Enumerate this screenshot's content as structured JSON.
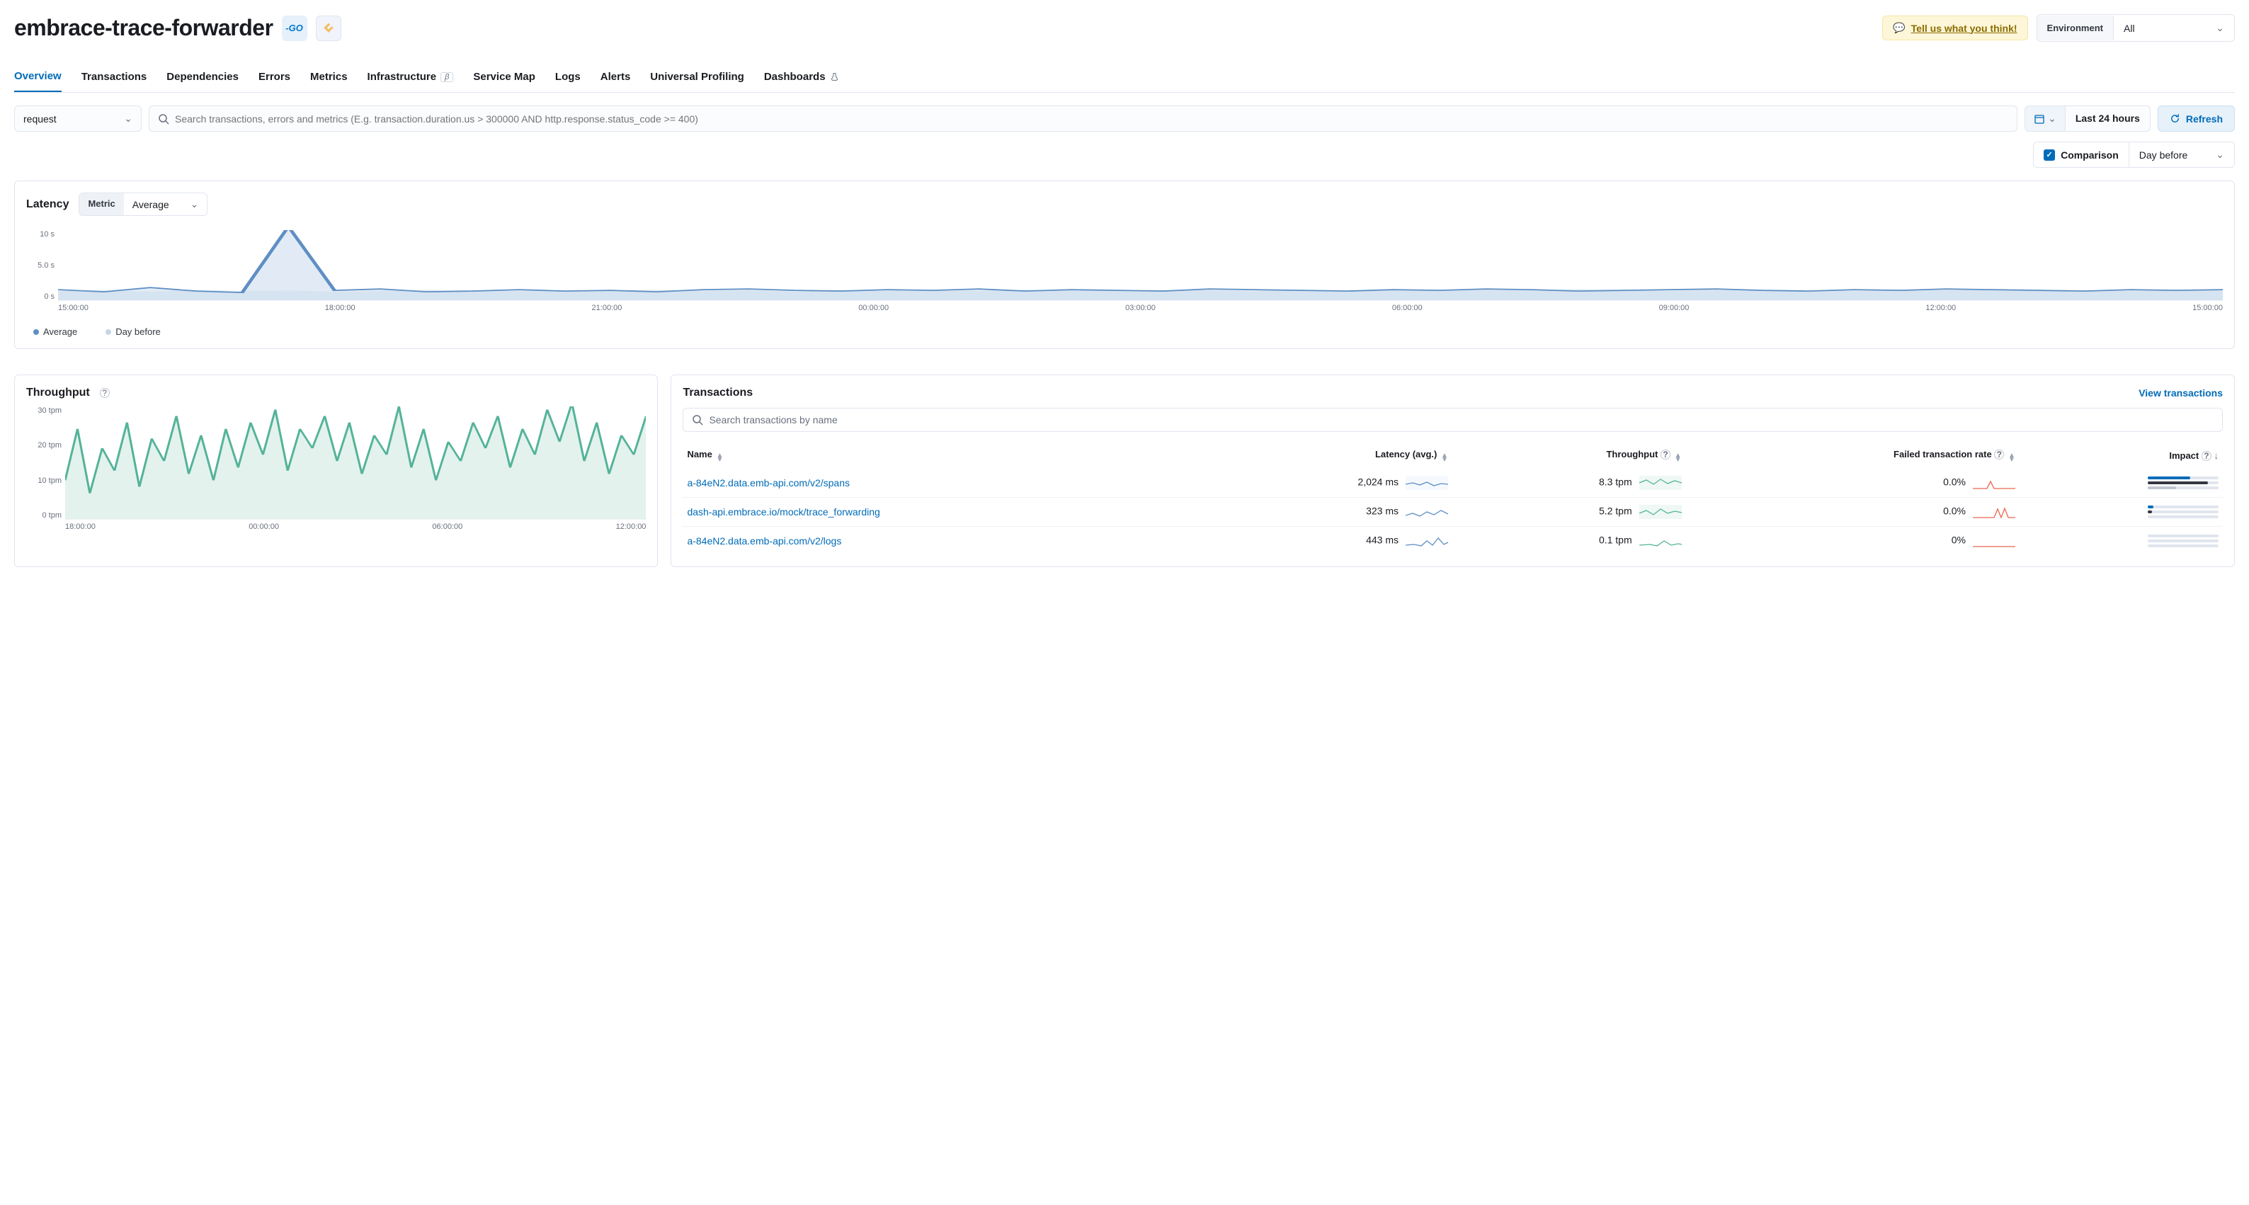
{
  "header": {
    "title": "embrace-trace-forwarder",
    "go_badge": "-GO",
    "feedback_label": "Tell us what you think!",
    "env_label": "Environment",
    "env_value": "All"
  },
  "tabs": [
    "Overview",
    "Transactions",
    "Dependencies",
    "Errors",
    "Metrics",
    "Infrastructure",
    "Service Map",
    "Logs",
    "Alerts",
    "Universal Profiling",
    "Dashboards"
  ],
  "tabs_active_index": 0,
  "tabs_beta_index": 5,
  "tabs_flask_index": 10,
  "filter": {
    "type_select": "request",
    "search_placeholder": "Search transactions, errors and metrics (E.g. transaction.duration.us > 300000 AND http.response.status_code >= 400)",
    "date_range": "Last 24 hours",
    "refresh_label": "Refresh"
  },
  "comparison": {
    "label": "Comparison",
    "value": "Day before"
  },
  "latency": {
    "title": "Latency",
    "metric_label": "Metric",
    "metric_value": "Average",
    "legend_avg": "Average",
    "legend_before": "Day before"
  },
  "throughput": {
    "title": "Throughput"
  },
  "transactions": {
    "title": "Transactions",
    "view_link": "View transactions",
    "search_placeholder": "Search transactions by name",
    "cols": {
      "name": "Name",
      "latency": "Latency (avg.)",
      "throughput": "Throughput",
      "failed": "Failed transaction rate",
      "impact": "Impact"
    },
    "rows": [
      {
        "name": "a-84eN2.data.emb-api.com/v2/spans",
        "latency": "2,024 ms",
        "throughput": "8.3 tpm",
        "failed": "0.0%"
      },
      {
        "name": "dash-api.embrace.io/mock/trace_forwarding",
        "latency": "323 ms",
        "throughput": "5.2 tpm",
        "failed": "0.0%"
      },
      {
        "name": "a-84eN2.data.emb-api.com/v2/logs",
        "latency": "443 ms",
        "throughput": "0.1 tpm",
        "failed": "0%"
      }
    ]
  },
  "chart_data": [
    {
      "type": "line",
      "title": "Latency",
      "ylabel": "seconds",
      "y_ticks": [
        "10 s",
        "5.0 s",
        "0 s"
      ],
      "x_ticks": [
        "15:00:00",
        "18:00:00",
        "21:00:00",
        "00:00:00",
        "03:00:00",
        "06:00:00",
        "09:00:00",
        "12:00:00",
        "15:00:00"
      ],
      "ylim": [
        0,
        10
      ],
      "series": [
        {
          "name": "Average",
          "color": "#5e8fc4",
          "values_approx_s": [
            1.5,
            1.2,
            1.8,
            1.3,
            1.1,
            10.5,
            1.4,
            1.6,
            1.2,
            1.3,
            1.5,
            1.3,
            1.4,
            1.2,
            1.5,
            1.6,
            1.4,
            1.3,
            1.5,
            1.4,
            1.6,
            1.3,
            1.5,
            1.4,
            1.3,
            1.6,
            1.5,
            1.4,
            1.3,
            1.5,
            1.4,
            1.6,
            1.5,
            1.3,
            1.4,
            1.5,
            1.6,
            1.4,
            1.3,
            1.5,
            1.4,
            1.6,
            1.5,
            1.4,
            1.3,
            1.5,
            1.4,
            1.5
          ]
        },
        {
          "name": "Day before",
          "color": "#c5d5e8",
          "values_approx_s": [
            1.3,
            1.4,
            1.2,
            1.5,
            1.3,
            1.4,
            1.2,
            1.3,
            1.5,
            1.4,
            1.3,
            1.2,
            1.4,
            1.5,
            1.3,
            1.4,
            1.2,
            1.5,
            1.3,
            1.4,
            1.3,
            1.5,
            1.4,
            1.3,
            1.5,
            1.4,
            1.3,
            1.5,
            1.4,
            1.6,
            1.3,
            1.5,
            1.4,
            1.6,
            1.5,
            1.3,
            1.4,
            1.5,
            1.4,
            1.3,
            1.5,
            1.4,
            1.6,
            1.5,
            1.4,
            1.3,
            1.5,
            1.4
          ]
        }
      ]
    },
    {
      "type": "line",
      "title": "Throughput",
      "ylabel": "tpm",
      "y_ticks": [
        "30 tpm",
        "20 tpm",
        "10 tpm",
        "0 tpm"
      ],
      "x_ticks": [
        "18:00:00",
        "00:00:00",
        "06:00:00",
        "12:00:00"
      ],
      "ylim": [
        0,
        35
      ],
      "series": [
        {
          "name": "Throughput",
          "color": "#54b399",
          "values_approx_tpm": [
            12,
            28,
            8,
            22,
            15,
            30,
            10,
            25,
            18,
            32,
            14,
            26,
            12,
            28,
            16,
            30,
            20,
            34,
            15,
            28,
            22,
            32,
            18,
            30,
            14,
            26,
            20,
            35,
            16,
            28,
            12,
            24,
            18,
            30,
            22,
            32,
            16,
            28,
            20,
            34,
            24,
            36,
            18,
            30,
            14,
            26,
            20,
            32
          ]
        }
      ]
    }
  ]
}
